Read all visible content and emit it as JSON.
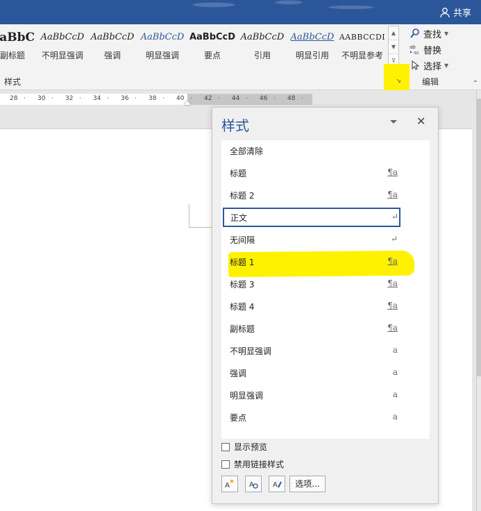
{
  "titlebar": {
    "share_label": "共享"
  },
  "ribbon": {
    "gallery": [
      {
        "preview": "AaBbC",
        "label": "副标题",
        "bold": true
      },
      {
        "preview": "AaBbCcD",
        "label": "不明显强调"
      },
      {
        "preview": "AaBbCcD",
        "label": "强调"
      },
      {
        "preview": "AaBbCcD",
        "label": "明显强调"
      },
      {
        "preview": "AaBbCcD",
        "label": "要点"
      },
      {
        "preview": "AaBbCcD",
        "label": "引用"
      },
      {
        "preview": "AaBbCcD",
        "label": "明显引用"
      },
      {
        "preview": "AABBCCDI",
        "label": "不明显参考"
      }
    ],
    "group_label": "样式",
    "editing": {
      "find": "查找",
      "replace": "替换",
      "select": "选择",
      "group_label": "编辑"
    }
  },
  "ruler": {
    "ticks": [
      "28",
      "30",
      "32",
      "34",
      "36",
      "38",
      "40",
      "42",
      "44",
      "46",
      "48"
    ]
  },
  "styles_pane": {
    "title": "样式",
    "items": [
      {
        "name": "全部清除",
        "symbol": ""
      },
      {
        "name": "标题",
        "symbol": "¶a"
      },
      {
        "name": "标题 2",
        "symbol": "¶a"
      },
      {
        "name": "正文",
        "symbol": "↵",
        "selected": true
      },
      {
        "name": "无间隔",
        "symbol": "↵"
      },
      {
        "name": "标题 1",
        "symbol": "¶a",
        "highlighted": true
      },
      {
        "name": "标题 3",
        "symbol": "¶a"
      },
      {
        "name": "标题 4",
        "symbol": "¶a"
      },
      {
        "name": "副标题",
        "symbol": "¶a"
      },
      {
        "name": "不明显强调",
        "symbol": "a"
      },
      {
        "name": "强调",
        "symbol": "a"
      },
      {
        "name": "明显强调",
        "symbol": "a"
      },
      {
        "name": "要点",
        "symbol": "a"
      }
    ],
    "show_preview": "显示预览",
    "disable_linked": "禁用链接样式",
    "options_button": "选项..."
  },
  "colors": {
    "accent": "#2b579a",
    "highlight": "#fef200"
  }
}
